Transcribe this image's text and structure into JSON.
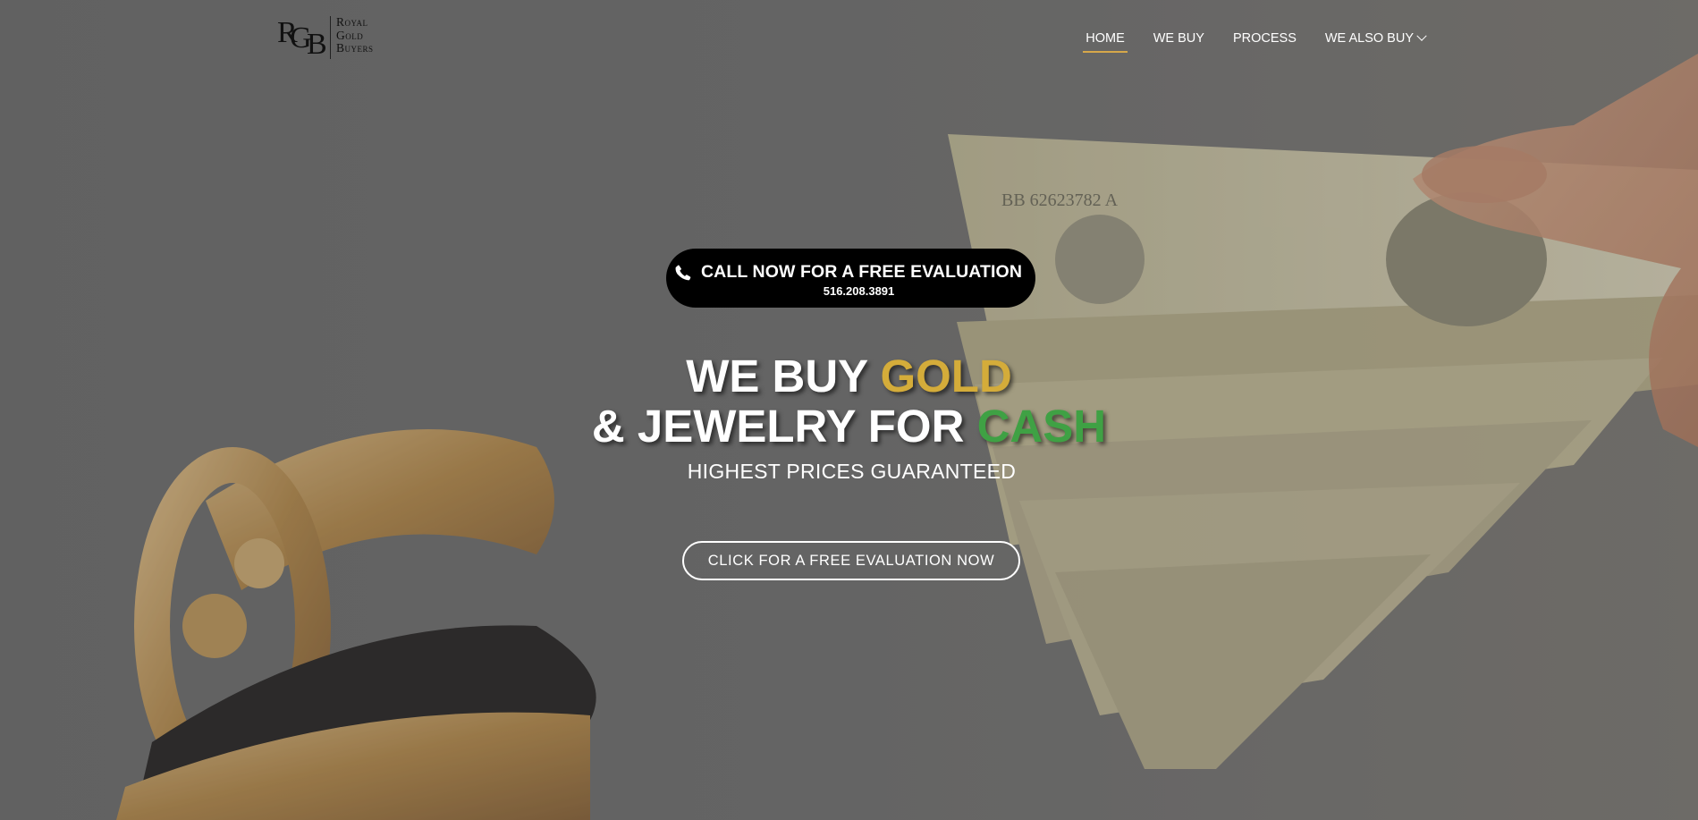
{
  "brand": {
    "line1": "Royal",
    "line2": "Gold",
    "line3": "Buyers",
    "monogram": "RGB"
  },
  "nav": {
    "items": [
      {
        "label": "HOME",
        "active": true
      },
      {
        "label": "WE BUY",
        "active": false
      },
      {
        "label": "PROCESS",
        "active": false
      },
      {
        "label": "WE ALSO BUY",
        "active": false
      }
    ],
    "active_color": "#d6a84a"
  },
  "call": {
    "label": "CALL NOW FOR A FREE EVALUATION",
    "phone": "516.208.3891",
    "icon": "phone-icon"
  },
  "headline": {
    "line1_prefix": "WE BUY ",
    "line1_highlight": "GOLD",
    "line2_prefix": "& JEWELRY FOR ",
    "line2_highlight": "CASH",
    "gold_color": "#d4ac3a",
    "cash_color": "#3fa144"
  },
  "subheadline": "HIGHEST PRICES GUARANTEED",
  "cta": {
    "label": "CLICK FOR A FREE EVALUATION NOW"
  }
}
